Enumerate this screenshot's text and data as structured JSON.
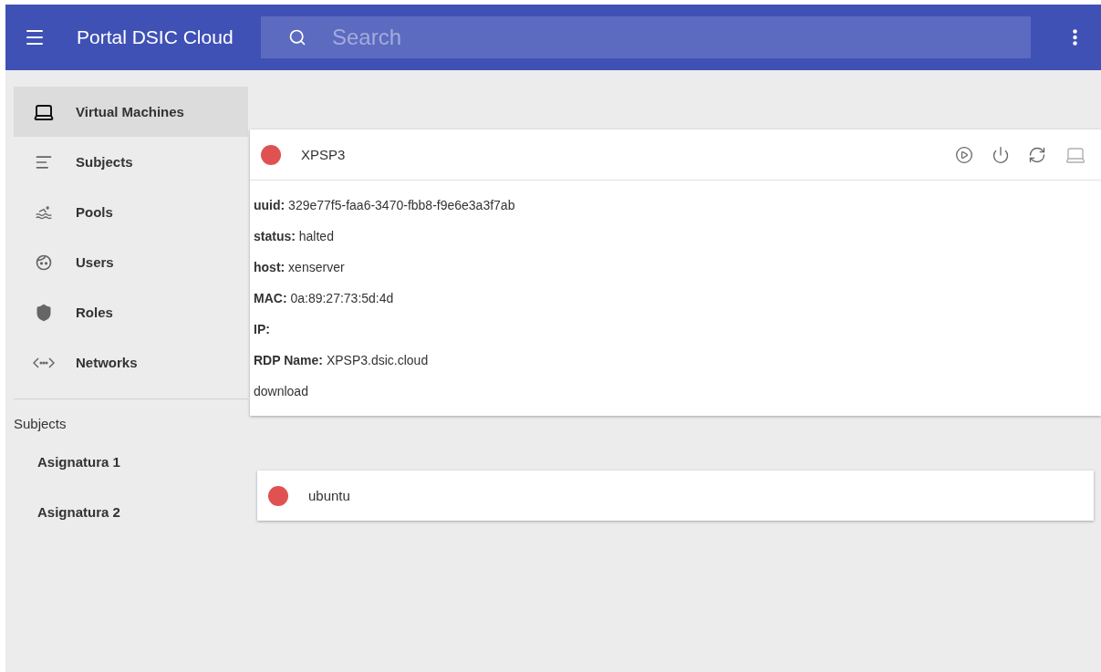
{
  "app_bar": {
    "title": "Portal DSIC Cloud",
    "search": {
      "placeholder": "Search"
    }
  },
  "sidebar": {
    "items": [
      {
        "label": "Virtual Machines",
        "kind": "laptop",
        "selected": true
      },
      {
        "label": "Subjects",
        "kind": "lines",
        "selected": false
      },
      {
        "label": "Pools",
        "kind": "pool",
        "selected": false
      },
      {
        "label": "Users",
        "kind": "face",
        "selected": false
      },
      {
        "label": "Roles",
        "kind": "shield",
        "selected": false
      },
      {
        "label": "Networks",
        "kind": "network",
        "selected": false
      }
    ],
    "section": {
      "title": "Subjects",
      "items": [
        {
          "label": "Asignatura 1"
        },
        {
          "label": "Asignatura 2"
        }
      ]
    }
  },
  "machines": [
    {
      "name": "XPSP3",
      "color": "#e05252",
      "expanded": true,
      "actions": [
        {
          "kind": "play",
          "disabled": false
        },
        {
          "kind": "power",
          "disabled": false
        },
        {
          "kind": "restart",
          "disabled": false
        },
        {
          "kind": "console",
          "disabled": true
        }
      ],
      "details": [
        {
          "kind": "field",
          "label": "uuid:",
          "value": "329e77f5-faa6-3470-fbb8-f9e6e3a3f7ab"
        },
        {
          "kind": "field",
          "label": "status:",
          "value": "halted"
        },
        {
          "kind": "field",
          "label": "host:",
          "value": "xenserver"
        },
        {
          "kind": "field",
          "label": "MAC:",
          "value": "0a:89:27:73:5d:4d"
        },
        {
          "kind": "field",
          "label": "IP:"
        },
        {
          "kind": "field",
          "label": "RDP Name:",
          "value": "XPSP3.dsic.cloud"
        },
        {
          "kind": "link",
          "value": "download"
        }
      ]
    },
    {
      "name": "ubuntu",
      "color": "#e05252",
      "expanded": false
    }
  ]
}
